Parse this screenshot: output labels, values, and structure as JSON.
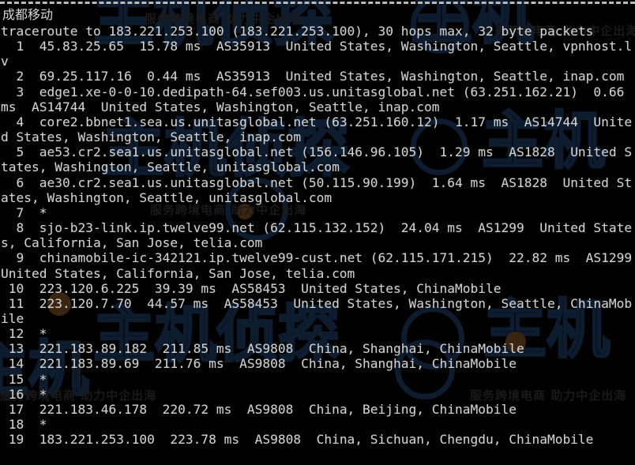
{
  "terminal": {
    "isp_label": "成都移动",
    "colors": {
      "background": "#010101",
      "text": "#d2d2d2",
      "rule": "#b9b9b9",
      "watermark": "#0d1c2e",
      "watermark_tag": "#1a1a1a"
    }
  },
  "traceroute": {
    "header": "traceroute to 183.221.253.100 (183.221.253.100), 30 hops max, 32 byte packets",
    "target_ip": "183.221.253.100",
    "max_hops": "30",
    "packet_size": "32 byte packets",
    "columns": [
      "hop",
      "host",
      "rtt",
      "asn",
      "location"
    ],
    "hops": [
      {
        "hop": "1",
        "host": "45.83.25.65",
        "rtt": "15.78 ms",
        "asn": "AS35913",
        "location": "United States, Washington, Seattle, vpnhost.lv",
        "line": "  1  45.83.25.65  15.78 ms  AS35913  United States, Washington, Seattle, vpnhost.lv"
      },
      {
        "hop": "2",
        "host": "69.25.117.16",
        "rtt": "0.44 ms",
        "asn": "AS35913",
        "location": "United States, Washington, Seattle, inap.com",
        "line": "  2  69.25.117.16  0.44 ms  AS35913  United States, Washington, Seattle, inap.com"
      },
      {
        "hop": "3",
        "host": "edge1.xe-0-0-10.dedipath-64.sef003.us.unitasglobal.net (63.251.162.21)",
        "rtt": "0.66 ms",
        "asn": "AS14744",
        "location": "United States, Washington, Seattle, inap.com",
        "line": "  3  edge1.xe-0-0-10.dedipath-64.sef003.us.unitasglobal.net (63.251.162.21)  0.66 ms  AS14744  United States, Washington, Seattle, inap.com"
      },
      {
        "hop": "4",
        "host": "core2.bbnet1.sea.us.unitasglobal.net (63.251.160.12)",
        "rtt": "1.17 ms",
        "asn": "AS14744",
        "location": "United States, Washington, Seattle, inap.com",
        "line": "  4  core2.bbnet1.sea.us.unitasglobal.net (63.251.160.12)  1.17 ms  AS14744  United States, Washington, Seattle, inap.com"
      },
      {
        "hop": "5",
        "host": "ae53.cr2.sea1.us.unitasglobal.net (156.146.96.105)",
        "rtt": "1.29 ms",
        "asn": "AS1828",
        "location": "United States, Washington, Seattle, unitasglobal.com",
        "line": "  5  ae53.cr2.sea1.us.unitasglobal.net (156.146.96.105)  1.29 ms  AS1828  United States, Washington, Seattle, unitasglobal.com"
      },
      {
        "hop": "6",
        "host": "ae30.cr2.sea1.us.unitasglobal.net (50.115.90.199)",
        "rtt": "1.64 ms",
        "asn": "AS1828",
        "location": "United States, Washington, Seattle, unitasglobal.com",
        "line": "  6  ae30.cr2.sea1.us.unitasglobal.net (50.115.90.199)  1.64 ms  AS1828  United States, Washington, Seattle, unitasglobal.com"
      },
      {
        "hop": "7",
        "host": "*",
        "rtt": "",
        "asn": "",
        "location": "",
        "line": "  7  *"
      },
      {
        "hop": "8",
        "host": "sjo-b23-link.ip.twelve99.net (62.115.132.152)",
        "rtt": "24.04 ms",
        "asn": "AS1299",
        "location": "United States, California, San Jose, telia.com",
        "line": "  8  sjo-b23-link.ip.twelve99.net (62.115.132.152)  24.04 ms  AS1299  United States, California, San Jose, telia.com"
      },
      {
        "hop": "9",
        "host": "chinamobile-ic-342121.ip.twelve99-cust.net (62.115.171.215)",
        "rtt": "22.82 ms",
        "asn": "AS1299",
        "location": "United States, California, San Jose, telia.com",
        "line": "  9  chinamobile-ic-342121.ip.twelve99-cust.net (62.115.171.215)  22.82 ms  AS1299  United States, California, San Jose, telia.com"
      },
      {
        "hop": "10",
        "host": "223.120.6.225",
        "rtt": "39.39 ms",
        "asn": "AS58453",
        "location": "United States, ChinaMobile",
        "line": " 10  223.120.6.225  39.39 ms  AS58453  United States, ChinaMobile"
      },
      {
        "hop": "11",
        "host": "223.120.7.70",
        "rtt": "44.57 ms",
        "asn": "AS58453",
        "location": "United States, Washington, Seattle, ChinaMobile",
        "line": " 11  223.120.7.70  44.57 ms  AS58453  United States, Washington, Seattle, ChinaMobile"
      },
      {
        "hop": "12",
        "host": "*",
        "rtt": "",
        "asn": "",
        "location": "",
        "line": " 12  *"
      },
      {
        "hop": "13",
        "host": "221.183.89.182",
        "rtt": "211.85 ms",
        "asn": "AS9808",
        "location": "China, Shanghai, ChinaMobile",
        "line": " 13  221.183.89.182  211.85 ms  AS9808  China, Shanghai, ChinaMobile"
      },
      {
        "hop": "14",
        "host": "221.183.89.69",
        "rtt": "211.76 ms",
        "asn": "AS9808",
        "location": "China, Shanghai, ChinaMobile",
        "line": " 14  221.183.89.69  211.76 ms  AS9808  China, Shanghai, ChinaMobile"
      },
      {
        "hop": "15",
        "host": "*",
        "rtt": "",
        "asn": "",
        "location": "",
        "line": " 15  *"
      },
      {
        "hop": "16",
        "host": "*",
        "rtt": "",
        "asn": "",
        "location": "",
        "line": " 16  *"
      },
      {
        "hop": "17",
        "host": "221.183.46.178",
        "rtt": "220.72 ms",
        "asn": "AS9808",
        "location": "China, Beijing, ChinaMobile",
        "line": " 17  221.183.46.178  220.72 ms  AS9808  China, Beijing, ChinaMobile"
      },
      {
        "hop": "18",
        "host": "*",
        "rtt": "",
        "asn": "",
        "location": "",
        "line": " 18  *"
      },
      {
        "hop": "19",
        "host": "183.221.253.100",
        "rtt": "223.78 ms",
        "asn": "AS9808",
        "location": "China, Sichuan, Chengdu, ChinaMobile",
        "line": " 19  183.221.253.100  223.78 ms  AS9808  China, Sichuan, Chengdu, ChinaMobile"
      }
    ]
  },
  "watermarks": {
    "tagline": "服务跨境电商 助力中企出海",
    "brand_main": "主机",
    "brand_secondary": "主机侦探",
    "brand_mark": "@"
  }
}
